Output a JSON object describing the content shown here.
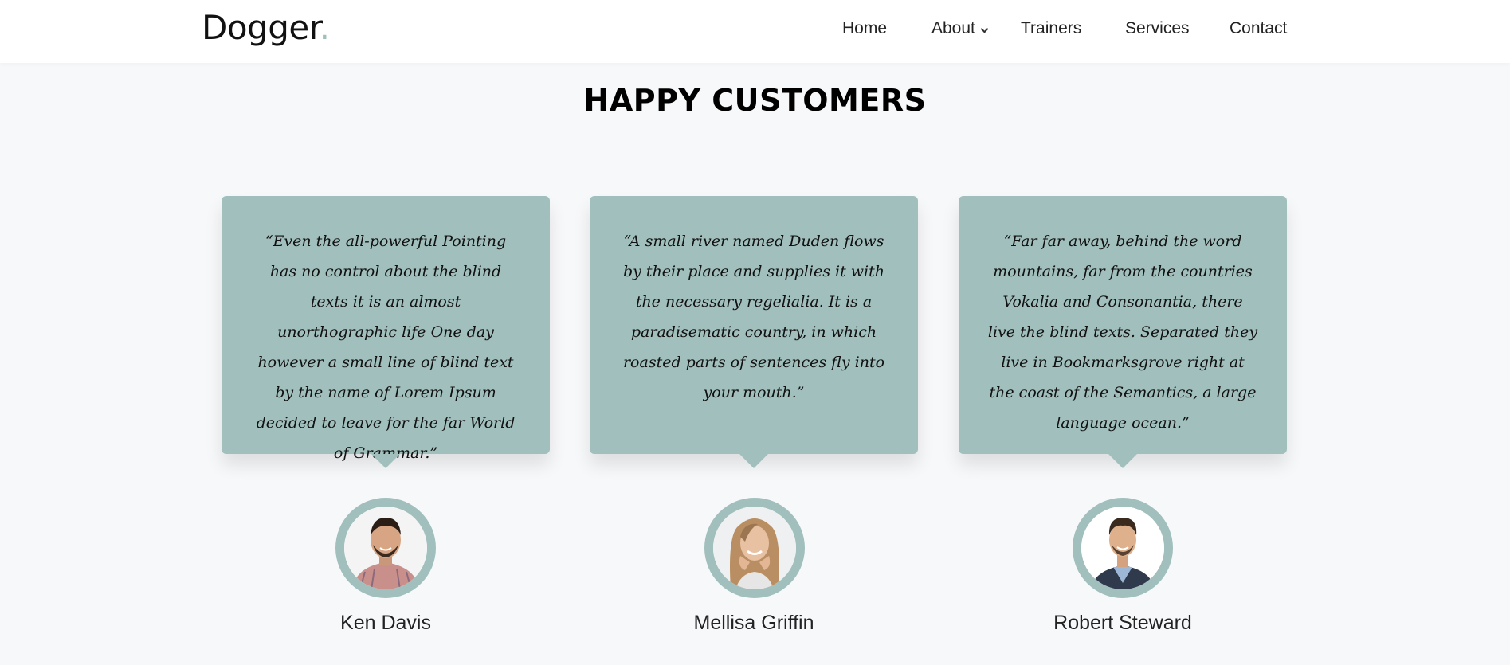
{
  "header": {
    "logo_text": "Dogger",
    "logo_dot": ".",
    "nav": {
      "home": "Home",
      "about": "About",
      "trainers": "Trainers",
      "services": "Services",
      "contact": "Contact"
    }
  },
  "section": {
    "title": "HAPPY CUSTOMERS"
  },
  "testimonials": [
    {
      "quote": "“Even the all-powerful Pointing has no control about the blind texts it is an almost unorthographic life One day however a small line of blind text by the name of Lorem Ipsum decided to leave for the far World of Grammar.”",
      "name": "Ken Davis"
    },
    {
      "quote": "“A small river named Duden flows by their place and supplies it with the necessary regelialia. It is a paradisematic country, in which roasted parts of sentences fly into your mouth.”",
      "name": "Mellisa Griffin"
    },
    {
      "quote": "“Far far away, behind the word mountains, far from the countries Vokalia and Consonantia, there live the blind texts. Separated they live in Bookmarksgrove right at the coast of the Semantics, a large language ocean.”",
      "name": "Robert Steward"
    }
  ],
  "colors": {
    "accent": "#a1bfbd",
    "background": "#f7f8fa",
    "header_bg": "#ffffff"
  }
}
